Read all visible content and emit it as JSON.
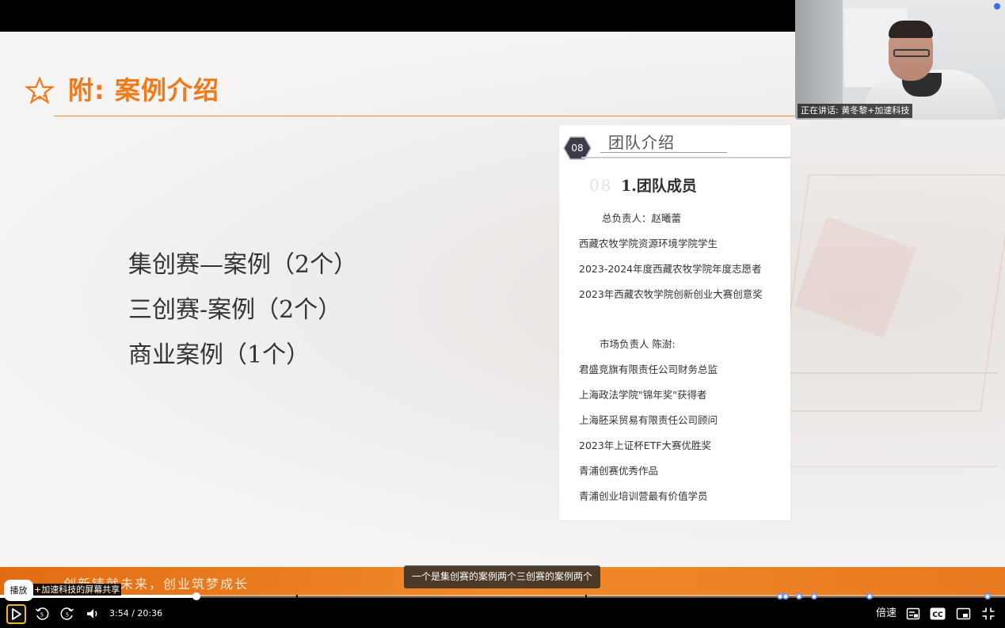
{
  "slide": {
    "title": "附: 案例介绍",
    "cases": [
      "集创赛—案例（2个）",
      "三创赛-案例（2个）",
      "商业案例（1个）"
    ],
    "slogan": "创新铸就未来，创业筑梦成长"
  },
  "card": {
    "badge": "08",
    "header_title": "团队介绍",
    "ghost_number": "08",
    "section_title": "1.团队成员",
    "lines": [
      "总负责人：赵曦蕾",
      "西藏农牧学院资源环境学院学生",
      "2023-2024年度西藏农牧学院年度志愿者",
      "2023年西藏农牧学院创新创业大赛创意奖",
      "市场负责人 陈澍:",
      "君盛竞旗有限责任公司财务总监",
      "上海政法学院\"锦年奖\"获得者",
      "上海胚采贸易有限责任公司顾问",
      "2023年上证杯ETF大赛优胜奖",
      "青浦创赛优秀作品",
      "青浦创业培训营最有价值学员"
    ]
  },
  "webcam": {
    "speaker_label": "正在讲话: 黄冬黎+加速科技"
  },
  "caption": "一个是集创赛的案例两个三创赛的案例两个",
  "player": {
    "play_tooltip": "播放",
    "share_label": "+加速科技的屏幕共享",
    "current_time": "3:54",
    "duration": "20:36",
    "time_display": "3:54 / 20:36",
    "progress_fraction": 0.1893,
    "skip_back_seconds": "5",
    "skip_forward_seconds": "5",
    "speed_label": "倍速",
    "icons": [
      "play-icon",
      "rewind-5-icon",
      "forward-5-icon",
      "volume-icon",
      "subtitle-list-icon",
      "cc-icon",
      "picture-in-picture-icon",
      "exit-fullscreen-icon"
    ]
  },
  "colors": {
    "accent_orange": "#ec7b1d",
    "play_button_border": "#f1b534",
    "marker_blue": "#6ea0ff"
  }
}
